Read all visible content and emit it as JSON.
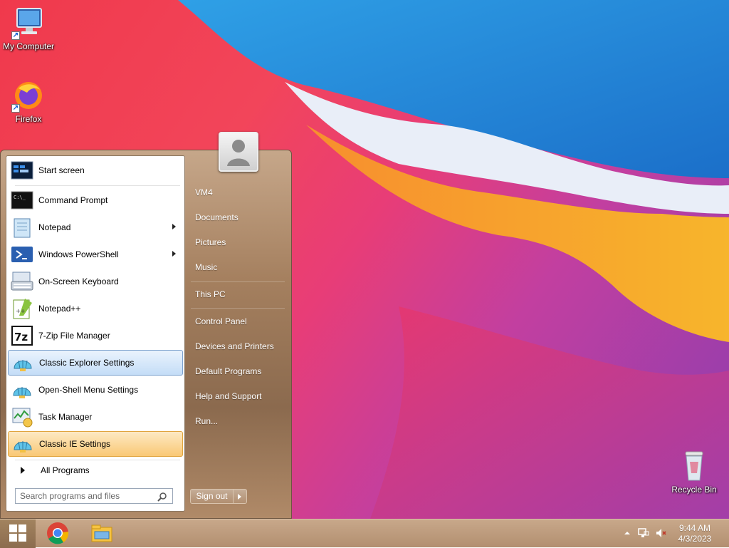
{
  "desktop": {
    "icons": [
      {
        "label": "My Computer",
        "icon": "computer-icon"
      },
      {
        "label": "Firefox",
        "icon": "firefox-icon"
      },
      {
        "label": "Recycle Bin",
        "icon": "recycle-bin-icon"
      }
    ]
  },
  "start_menu": {
    "user_picture": "user-avatar-icon",
    "programs": [
      {
        "label": "Start screen",
        "icon": "start-screen-icon",
        "submenu": false
      },
      {
        "label": "Command Prompt",
        "icon": "command-prompt-icon",
        "submenu": false
      },
      {
        "label": "Notepad",
        "icon": "notepad-icon",
        "submenu": true
      },
      {
        "label": "Windows PowerShell",
        "icon": "powershell-icon",
        "submenu": true
      },
      {
        "label": "On-Screen Keyboard",
        "icon": "keyboard-icon",
        "submenu": false
      },
      {
        "label": "Notepad++",
        "icon": "notepad-plus-plus-icon",
        "submenu": false
      },
      {
        "label": "7-Zip File Manager",
        "icon": "7zip-icon",
        "submenu": false
      },
      {
        "label": "Classic Explorer Settings",
        "icon": "shell-icon",
        "submenu": false,
        "state": "hover"
      },
      {
        "label": "Open-Shell Menu Settings",
        "icon": "shell-icon",
        "submenu": false
      },
      {
        "label": "Task Manager",
        "icon": "task-manager-icon",
        "submenu": false
      },
      {
        "label": "Classic IE Settings",
        "icon": "shell-icon",
        "submenu": false,
        "state": "selected"
      }
    ],
    "all_programs_label": "All Programs",
    "search_placeholder": "Search programs and files",
    "right_links": [
      "VM4",
      "Documents",
      "Pictures",
      "Music",
      "This PC",
      "Control Panel",
      "Devices and Printers",
      "Default Programs",
      "Help and Support",
      "Run..."
    ],
    "sign_out_label": "Sign out"
  },
  "taskbar": {
    "pinned": [
      "chrome-icon",
      "file-explorer-icon"
    ],
    "tray_icons": [
      "show-hidden-icons-icon",
      "network-icon",
      "volume-muted-icon"
    ],
    "time": "9:44 AM",
    "date": "4/3/2023"
  },
  "colors": {
    "menu_brown": "#a5805f",
    "hover_blue": "#c4ddf7",
    "selected_orange": "#f9c875"
  }
}
